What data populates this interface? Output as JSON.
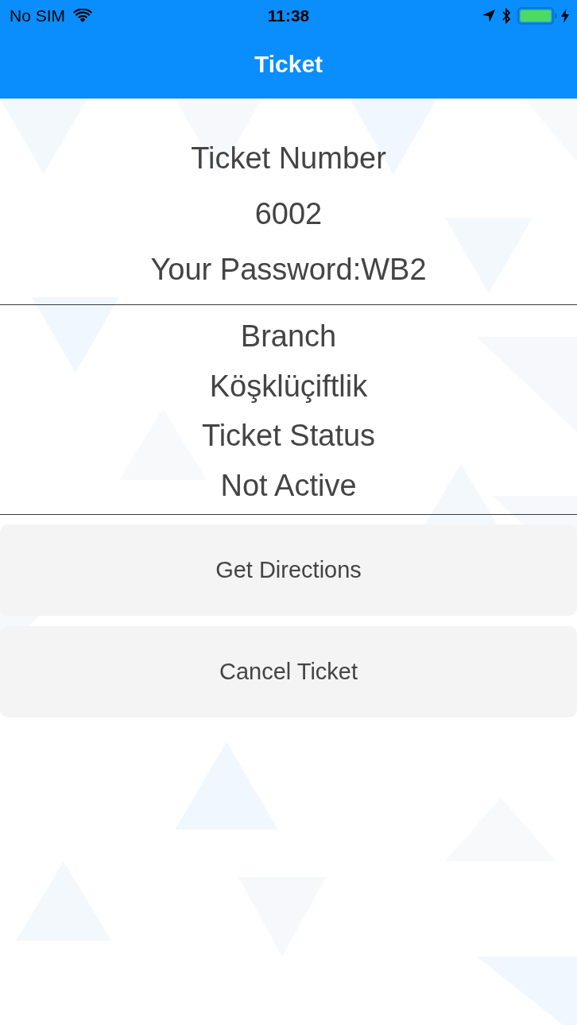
{
  "status_bar": {
    "carrier": "No SIM",
    "time": "11:38",
    "charging": true
  },
  "nav_bar": {
    "title": "Ticket"
  },
  "ticket": {
    "number_label": "Ticket Number",
    "number": "6002",
    "password": "Your Password:WB2"
  },
  "details": [
    {
      "label": "Branch",
      "value": "Köşklüçiftlik"
    },
    {
      "label": "Ticket Status",
      "value": "Not Active"
    }
  ],
  "buttons": [
    "Get Directions",
    "Cancel Ticket"
  ]
}
